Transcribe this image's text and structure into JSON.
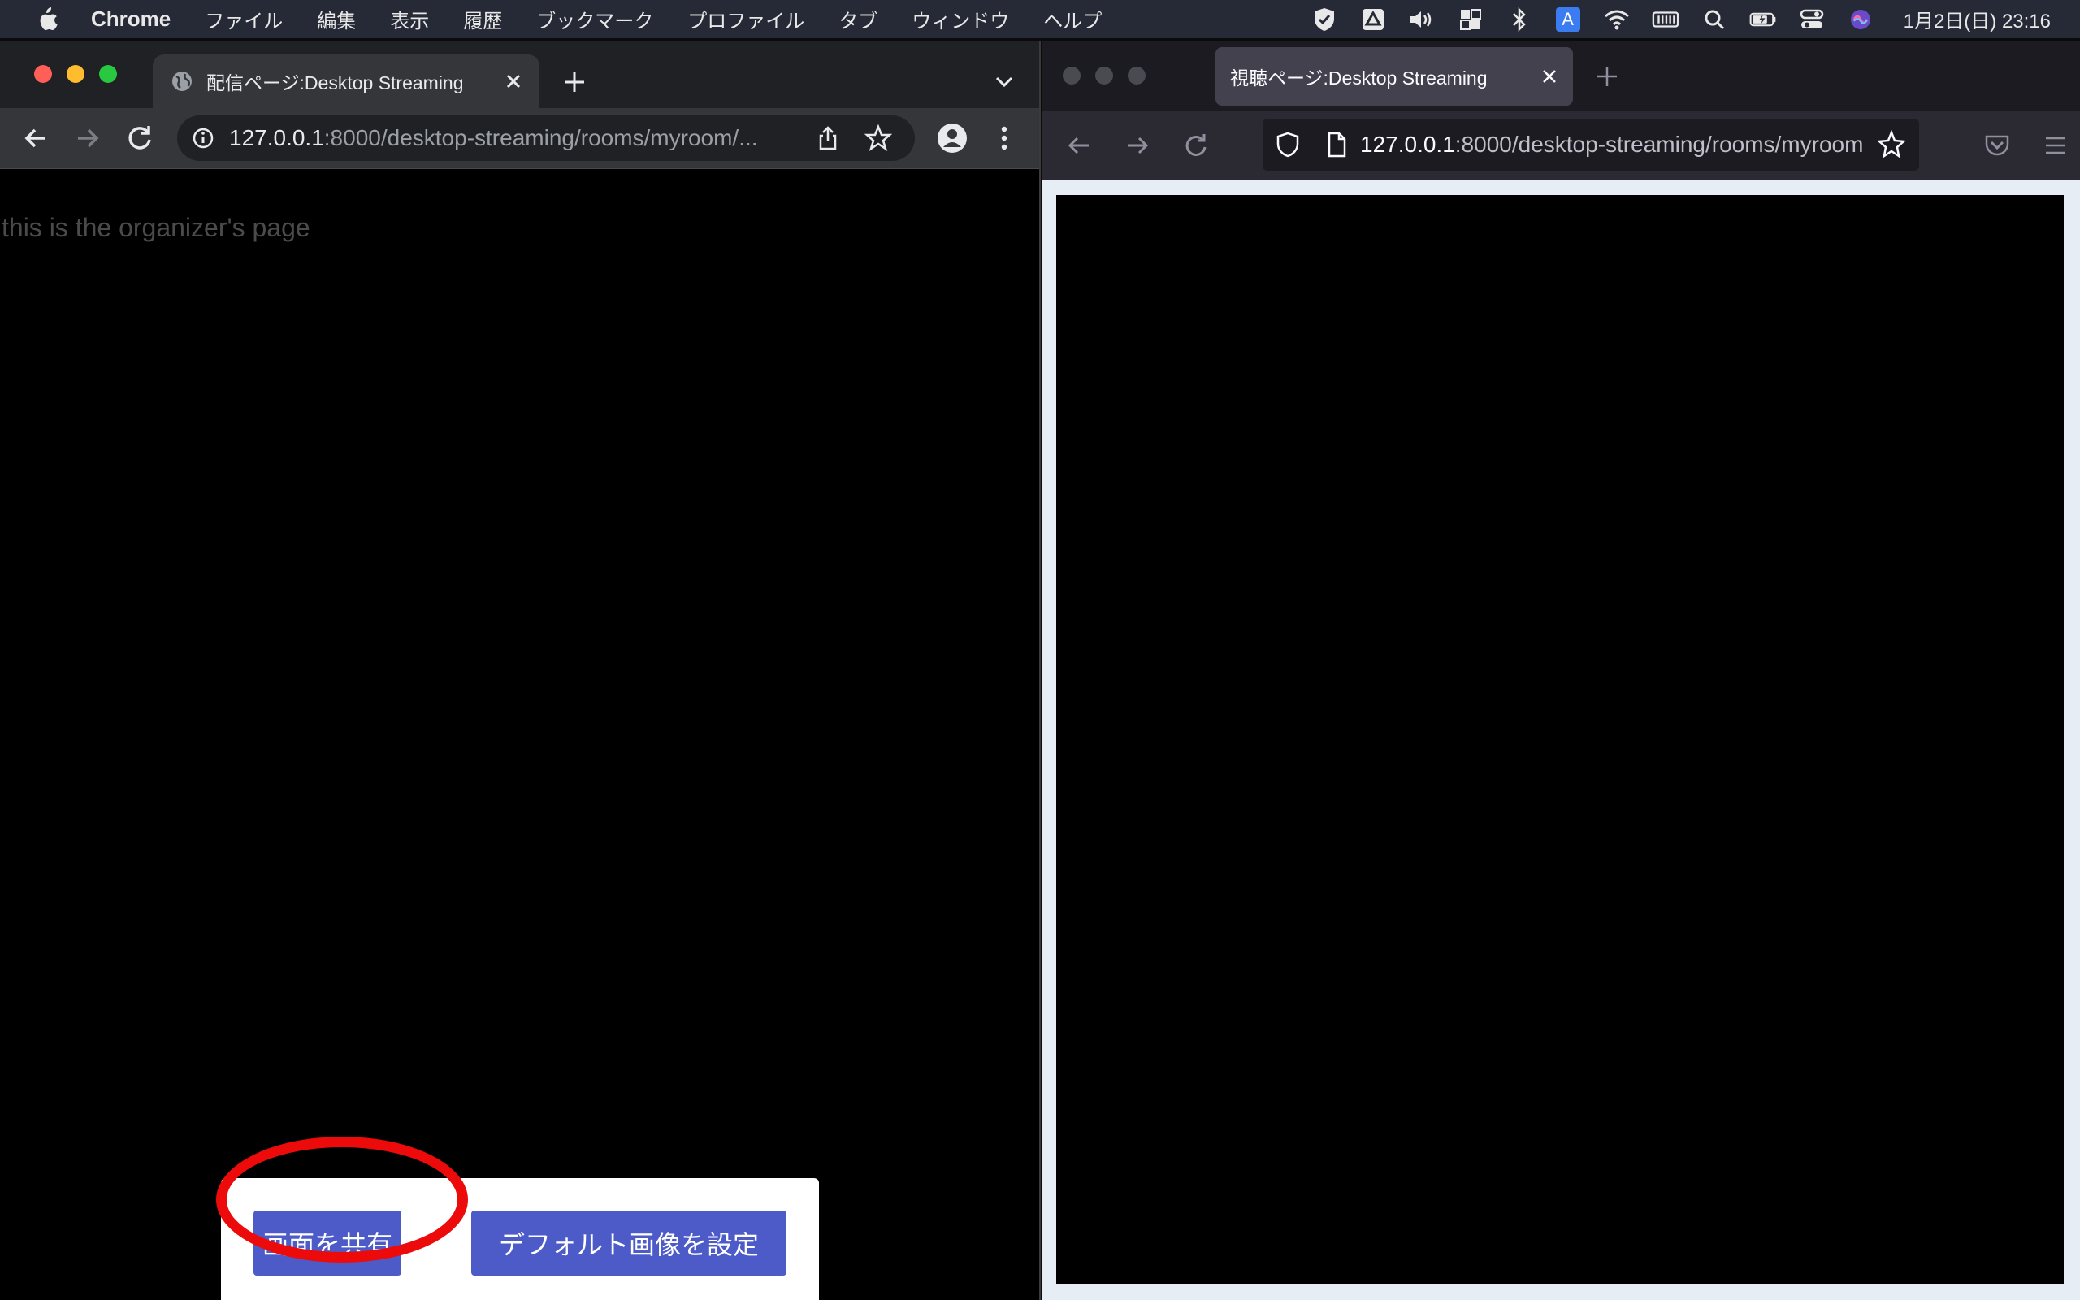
{
  "menubar": {
    "app_name": "Chrome",
    "items": [
      "ファイル",
      "編集",
      "表示",
      "履歴",
      "ブックマーク",
      "プロファイル",
      "タブ",
      "ウィンドウ",
      "ヘルプ"
    ],
    "clock": "1月2日(日)  23:16",
    "input_indicator": "A"
  },
  "chrome": {
    "tab_title": "配信ページ:Desktop Streaming",
    "url_host": "127.0.0.1",
    "url_path": ":8000/desktop-streaming/rooms/myroom/...",
    "page_text": "this is the organizer's page",
    "buttons": {
      "share": "画面を共有",
      "default_image": "デフォルト画像を設定"
    }
  },
  "firefox": {
    "tab_title": "視聴ページ:Desktop Streaming",
    "url_host": "127.0.0.1",
    "url_path": ":8000/desktop-streaming/rooms/myroom"
  },
  "colors": {
    "button": "#4d5bc8",
    "highlight_ring": "#ec0a0a",
    "menubar": "#262a36"
  }
}
